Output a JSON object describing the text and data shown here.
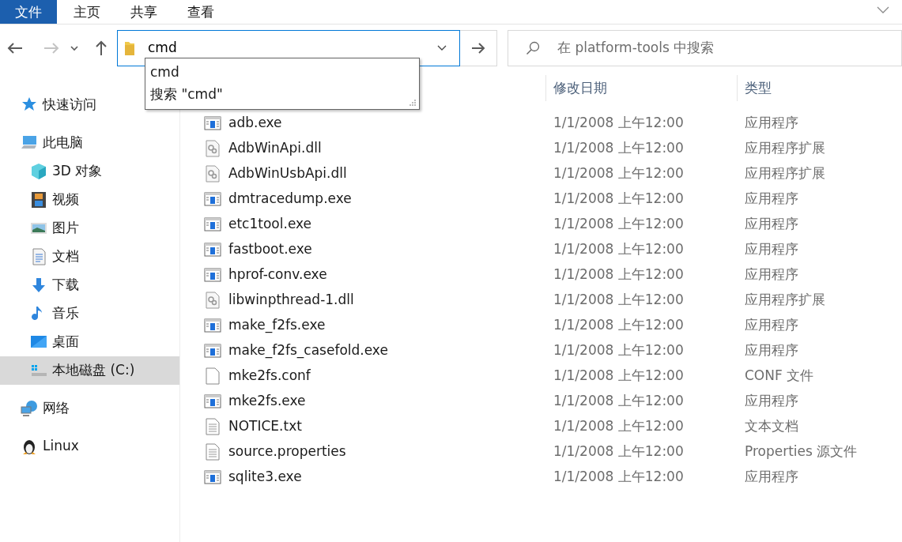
{
  "ribbon_tabs": [
    {
      "label": "文件",
      "selected": true
    },
    {
      "label": "主页",
      "selected": false
    },
    {
      "label": "共享",
      "selected": false
    },
    {
      "label": "查看",
      "selected": false
    }
  ],
  "address": {
    "value": "cmd"
  },
  "autocomplete": [
    "cmd",
    "搜索 \"cmd\""
  ],
  "search": {
    "placeholder": "在 platform-tools 中搜索"
  },
  "sidebar": {
    "items": [
      {
        "label": "快速访问",
        "kind": "star",
        "selected": false
      },
      {
        "label": "此电脑",
        "kind": "pc",
        "selected": false,
        "children": [
          {
            "label": "3D 对象",
            "kind": "cube",
            "selected": false
          },
          {
            "label": "视频",
            "kind": "video",
            "selected": false
          },
          {
            "label": "图片",
            "kind": "pictures",
            "selected": false
          },
          {
            "label": "文档",
            "kind": "document",
            "selected": false
          },
          {
            "label": "下载",
            "kind": "download",
            "selected": false
          },
          {
            "label": "音乐",
            "kind": "music",
            "selected": false
          },
          {
            "label": "桌面",
            "kind": "desktop",
            "selected": false
          },
          {
            "label": "本地磁盘 (C:)",
            "kind": "drive",
            "selected": true
          }
        ]
      },
      {
        "label": "网络",
        "kind": "network",
        "selected": false
      },
      {
        "label": "Linux",
        "kind": "penguin",
        "selected": false
      }
    ]
  },
  "table": {
    "columns": [
      "修改日期",
      "类型"
    ],
    "rows": [
      {
        "name": "adb.exe",
        "kind": "exe",
        "date": "1/1/2008 上午12:00",
        "type": "应用程序"
      },
      {
        "name": "AdbWinApi.dll",
        "kind": "dll",
        "date": "1/1/2008 上午12:00",
        "type": "应用程序扩展"
      },
      {
        "name": "AdbWinUsbApi.dll",
        "kind": "dll",
        "date": "1/1/2008 上午12:00",
        "type": "应用程序扩展"
      },
      {
        "name": "dmtracedump.exe",
        "kind": "exe",
        "date": "1/1/2008 上午12:00",
        "type": "应用程序"
      },
      {
        "name": "etc1tool.exe",
        "kind": "exe",
        "date": "1/1/2008 上午12:00",
        "type": "应用程序"
      },
      {
        "name": "fastboot.exe",
        "kind": "exe",
        "date": "1/1/2008 上午12:00",
        "type": "应用程序"
      },
      {
        "name": "hprof-conv.exe",
        "kind": "exe",
        "date": "1/1/2008 上午12:00",
        "type": "应用程序"
      },
      {
        "name": "libwinpthread-1.dll",
        "kind": "dll",
        "date": "1/1/2008 上午12:00",
        "type": "应用程序扩展"
      },
      {
        "name": "make_f2fs.exe",
        "kind": "exe",
        "date": "1/1/2008 上午12:00",
        "type": "应用程序"
      },
      {
        "name": "make_f2fs_casefold.exe",
        "kind": "exe",
        "date": "1/1/2008 上午12:00",
        "type": "应用程序"
      },
      {
        "name": "mke2fs.conf",
        "kind": "blank",
        "date": "1/1/2008 上午12:00",
        "type": "CONF 文件"
      },
      {
        "name": "mke2fs.exe",
        "kind": "exe",
        "date": "1/1/2008 上午12:00",
        "type": "应用程序"
      },
      {
        "name": "NOTICE.txt",
        "kind": "text",
        "date": "1/1/2008 上午12:00",
        "type": "文本文档"
      },
      {
        "name": "source.properties",
        "kind": "text",
        "date": "1/1/2008 上午12:00",
        "type": "Properties 源文件"
      },
      {
        "name": "sqlite3.exe",
        "kind": "exe",
        "date": "1/1/2008 上午12:00",
        "type": "应用程序"
      }
    ]
  }
}
